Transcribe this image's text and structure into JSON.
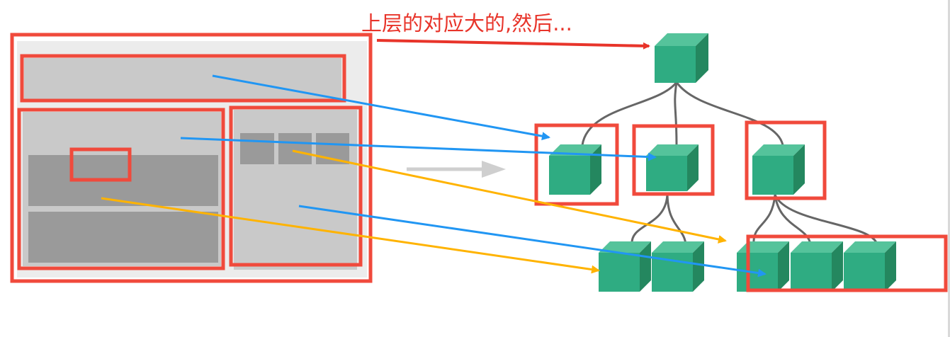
{
  "caption": "上层的对应大的,然后...",
  "colors": {
    "frame_red": "#f04a3c",
    "caption_red": "#e8342a",
    "blue_arrow": "#2196f3",
    "yellow_arrow": "#ffb300",
    "gray_arrow": "#cfcfcf",
    "panel_light": "#c9c9c9",
    "panel_dark": "#9a9a9a",
    "cube_front": "#2fac82",
    "cube_top": "#55c39b",
    "cube_side": "#24875f",
    "tree_line": "#666666"
  },
  "layout_panel": {
    "regions": [
      "header-bar",
      "left-content-area",
      "small-highlight-box",
      "gray-block-top",
      "gray-block-bottom",
      "right-sidebar",
      "sidebar-tile-1",
      "sidebar-tile-2",
      "sidebar-tile-3"
    ]
  },
  "tree": {
    "nodes": [
      "root",
      "child-left",
      "child-middle",
      "child-right",
      "grandchild-1",
      "grandchild-2",
      "grandchild-3",
      "grandchild-4",
      "grandchild-5"
    ],
    "highlighted": [
      "child-left",
      "child-middle",
      "child-right",
      "grandchild-group-right"
    ]
  }
}
